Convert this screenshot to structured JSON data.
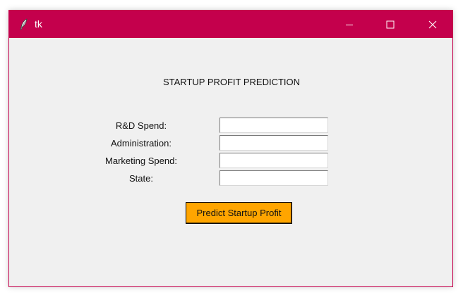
{
  "window": {
    "title": "tk",
    "icon": "feather-icon",
    "accent_color": "#c4004c"
  },
  "form": {
    "heading": "STARTUP PROFIT PREDICTION",
    "fields": [
      {
        "label": "R&D Spend:",
        "value": ""
      },
      {
        "label": "Administration:",
        "value": ""
      },
      {
        "label": "Marketing Spend:",
        "value": ""
      },
      {
        "label": "State:",
        "value": ""
      }
    ],
    "submit_label": "Predict Startup Profit",
    "submit_color": "#ffa500"
  }
}
